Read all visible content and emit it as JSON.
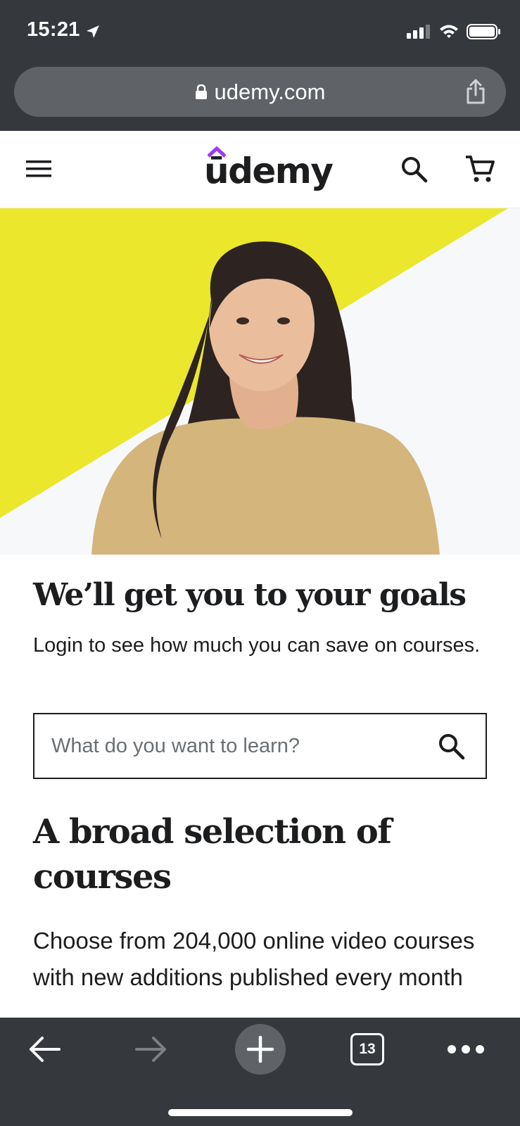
{
  "status_bar": {
    "time": "15:21",
    "icons": [
      "location-arrow-icon",
      "cellular-signal-icon",
      "wifi-icon",
      "battery-icon"
    ]
  },
  "browser": {
    "url": "udemy.com",
    "icons": [
      "lock-icon",
      "share-icon"
    ]
  },
  "site_header": {
    "logo_text": "ūdemy",
    "icons": [
      "menu-icon",
      "search-icon",
      "cart-icon"
    ],
    "brand_accent": "#a435f0"
  },
  "hero": {
    "accent_color": "#eae72c",
    "background_color": "#f7f8fa"
  },
  "main": {
    "headline": "We’ll get you to your goals",
    "subtext": "Login to see how much you can save on courses.",
    "search": {
      "placeholder": "What do you want to learn?",
      "value": ""
    },
    "section_title": "A broad selection of courses",
    "section_desc": "Choose from 204,000 online video courses with new additions published every month"
  },
  "toolbar": {
    "tab_count": "13",
    "icons": [
      "back-arrow-icon",
      "forward-arrow-icon",
      "plus-icon",
      "tabs-icon",
      "more-icon"
    ]
  }
}
